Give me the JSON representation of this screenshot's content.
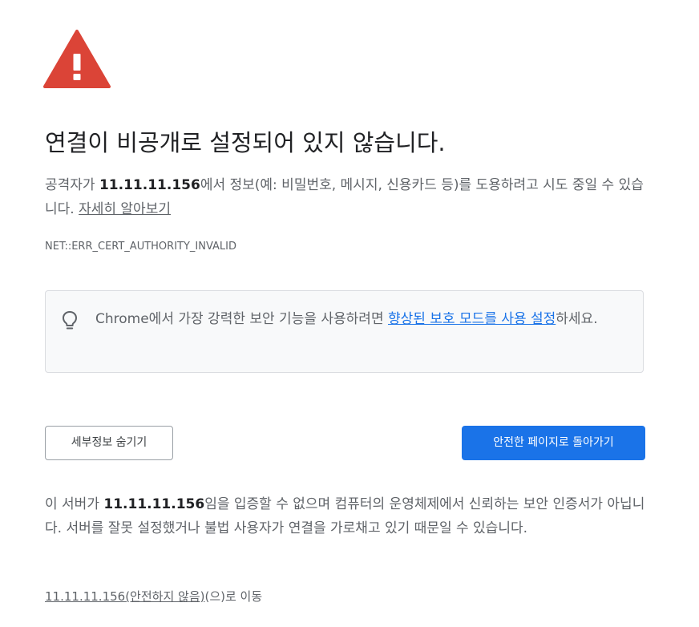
{
  "icons": {
    "warning": "red-warning-triangle",
    "tip": "lightbulb"
  },
  "colors": {
    "warning_red": "#db4437",
    "primary_button": "#1a73e8",
    "link_blue": "#1a73e8"
  },
  "header": {
    "title": "연결이 비공개로 설정되어 있지 않습니다."
  },
  "intro": {
    "prefix": "공격자가 ",
    "host": "11.11.11.156",
    "suffix": "에서 정보(예: 비밀번호, 메시지, 신용카드 등)를 도용하려고 시도 중일 수 있습니다. ",
    "learn_more_link": "자세히 알아보기"
  },
  "error_code": "NET::ERR_CERT_AUTHORITY_INVALID",
  "tip": {
    "prefix": "Chrome에서 가장 강력한 보안 기능을 사용하려면 ",
    "link": "향상된 보호 모드를 사용 설정",
    "suffix": "하세요."
  },
  "buttons": {
    "hide_details": "세부정보 숨기기",
    "back_to_safety": "안전한 페이지로 돌아가기"
  },
  "details": {
    "prefix": "이 서버가 ",
    "host": "11.11.11.156",
    "suffix": "임을 입증할 수 없으며 컴퓨터의 운영체제에서 신뢰하는 보안 인증서가 아닙니다. 서버를 잘못 설정했거나 불법 사용자가 연결을 가로채고 있기 때문일 수 있습니다."
  },
  "proceed": {
    "link": "11.11.11.156(안전하지 않음)",
    "suffix": "(으)로 이동"
  }
}
